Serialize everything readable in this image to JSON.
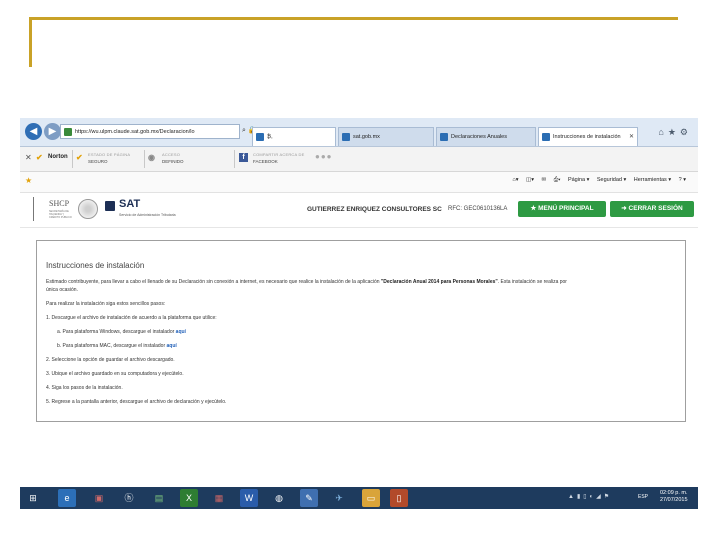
{
  "browser": {
    "url": "https://wu.ulpm.claude.sat.gob.mx/Declaracion/lo",
    "tabs": [
      {
        "label": "sat.gob.mx"
      },
      {
        "label": "Declaraciones Anuales"
      },
      {
        "label": "Instrucciones de instalación"
      }
    ],
    "url_stub": "₿,"
  },
  "norton": {
    "brand": "Norton",
    "page_status_label": "ESTADO DE PÁGINA",
    "page_status_value": "SEGURO",
    "access_label": "ACCESO",
    "access_value": "DEFINIDO",
    "share_label": "COMPARTIR ACERCA DE",
    "share_value": "FACEBOOK"
  },
  "commandbar": {
    "page": "Página ▾",
    "security": "Seguridad ▾",
    "tools": "Herramientas ▾",
    "help": "? ▾"
  },
  "sat_header": {
    "shcp": "SHCP",
    "shcp_sub": "SECRETARÍA DE HACIENDA Y CRÉDITO PÚBLICO",
    "sat": "SAT",
    "sat_sub": "Servicio de Administración Tributaria",
    "company": "GUTIERREZ ENRIQUEZ CONSULTORES SC",
    "rfc": "RFC: GEC0610136LA",
    "menu_button": "★ MENÚ PRINCIPAL",
    "logout_button": "➜ CERRAR SESIÓN"
  },
  "content": {
    "title": "Instrucciones de instalación",
    "intro_pre": "Estimado contribuyente, para llevar a cabo el llenado de su Declaración sin conexión a internet, es necesario que realice la instalación de la aplicación ",
    "intro_bold": "\"Declaración Anual 2014 para Personas Morales\"",
    "intro_post": ". Esta instalación se realiza por",
    "intro_line2": "única ocasión.",
    "steps_intro": "Para realizar la instalación siga estos sencillos pasos:",
    "step1": "1.  Descargue el archivo de instalación de acuerdo a la plataforma que utilice:",
    "step1a_text": "a. Para plataforma Windows, descargue el instalador ",
    "step1a_link": "aquí",
    "step1b_text": "b. Para plataforma MAC, descargue el instalador ",
    "step1b_link": "aquí",
    "step2": "2.  Seleccione la opción de guardar el archivo descargado.",
    "step3": "3.  Ubique el archivo guardado en su computadora y ejecútelo.",
    "step4": "4.  Siga los pasos de la instalación.",
    "step5": "5.  Regrese a la pantalla anterior, descargue el archivo de declaración y ejecútelo."
  },
  "taskbar": {
    "language": "ESP",
    "time": "02:09 p. m.",
    "date": "27/07/2015"
  }
}
